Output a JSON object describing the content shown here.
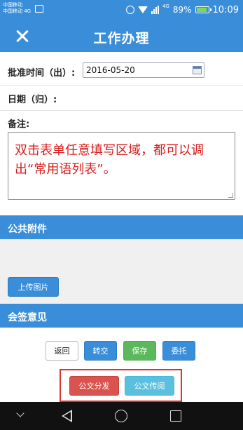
{
  "status_bar": {
    "carrier_line1": "中国移动",
    "carrier_line2": "中国移动 4G",
    "network": "4G",
    "battery": "89%",
    "battery_level": 0.89,
    "time": "10:09"
  },
  "header": {
    "title": "工作办理"
  },
  "form": {
    "approve_time_label": "批准时间（出）:",
    "approve_time_value": "2016-05-20",
    "return_date_label": "日期（归）:",
    "remark_label": "备注:",
    "remark_hint": "双击表单任意填写区域，都可以调出“常用语列表”。"
  },
  "attachments": {
    "title": "公共附件",
    "upload_label": "上传图片"
  },
  "countersign": {
    "title": "会签意见"
  },
  "actions": {
    "back_label": "返回",
    "transfer_label": "转交",
    "save_label": "保存",
    "delegate_label": "委托",
    "distribute_label": "公文分发",
    "circulate_label": "公文传阅"
  },
  "colors": {
    "primary": "#3a8ed9",
    "hint_text": "#d91c1c",
    "highlight": "#e0302a",
    "save": "#5cb85c",
    "distribute": "#d9534f",
    "circulate": "#5bc0de"
  }
}
